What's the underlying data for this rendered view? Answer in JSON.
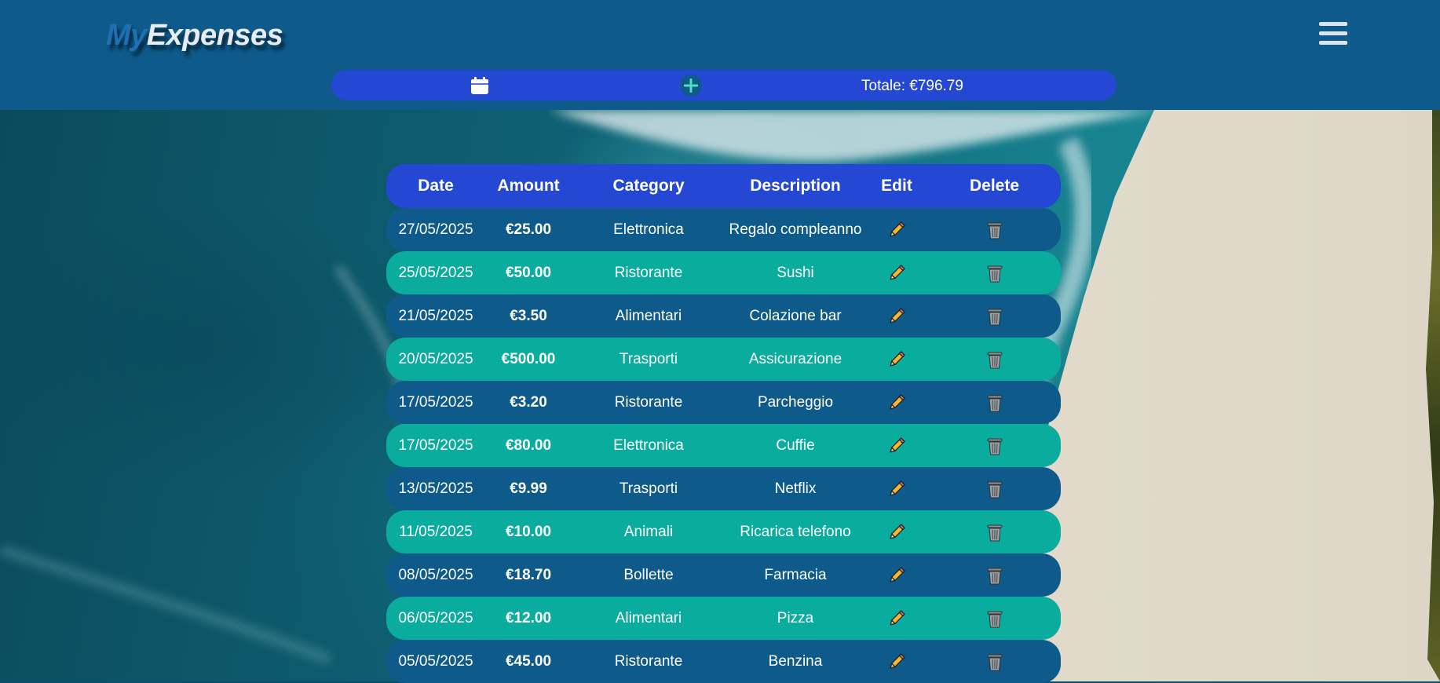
{
  "app": {
    "logo_my": "My",
    "logo_expenses": "Expenses"
  },
  "toolbar": {
    "calendar_icon": "calendar-icon",
    "add_icon": "plus-icon",
    "total": "Totale: €796.79"
  },
  "table": {
    "headers": [
      "Date",
      "Amount",
      "Category",
      "Description",
      "Edit",
      "Delete"
    ],
    "rows": [
      {
        "date": "27/05/2025",
        "amount": "€25.00",
        "category": "Elettronica",
        "description": "Regalo compleanno"
      },
      {
        "date": "25/05/2025",
        "amount": "€50.00",
        "category": "Ristorante",
        "description": "Sushi"
      },
      {
        "date": "21/05/2025",
        "amount": "€3.50",
        "category": "Alimentari",
        "description": "Colazione bar"
      },
      {
        "date": "20/05/2025",
        "amount": "€500.00",
        "category": "Trasporti",
        "description": "Assicurazione"
      },
      {
        "date": "17/05/2025",
        "amount": "€3.20",
        "category": "Ristorante",
        "description": "Parcheggio"
      },
      {
        "date": "17/05/2025",
        "amount": "€80.00",
        "category": "Elettronica",
        "description": "Cuffie"
      },
      {
        "date": "13/05/2025",
        "amount": "€9.99",
        "category": "Trasporti",
        "description": "Netflix"
      },
      {
        "date": "11/05/2025",
        "amount": "€10.00",
        "category": "Animali",
        "description": "Ricarica telefono"
      },
      {
        "date": "08/05/2025",
        "amount": "€18.70",
        "category": "Bollette",
        "description": "Farmacia"
      },
      {
        "date": "06/05/2025",
        "amount": "€12.00",
        "category": "Alimentari",
        "description": "Pizza"
      },
      {
        "date": "05/05/2025",
        "amount": "€45.00",
        "category": "Ristorante",
        "description": "Benzina"
      }
    ]
  },
  "colors": {
    "header_bg": "#0e5a8a",
    "accent_blue": "#2448d4",
    "row_dark": "#0e5a8a",
    "row_teal": "#0aac9e",
    "edit_icon": "#f5b731",
    "delete_icon": "#8a9095"
  }
}
